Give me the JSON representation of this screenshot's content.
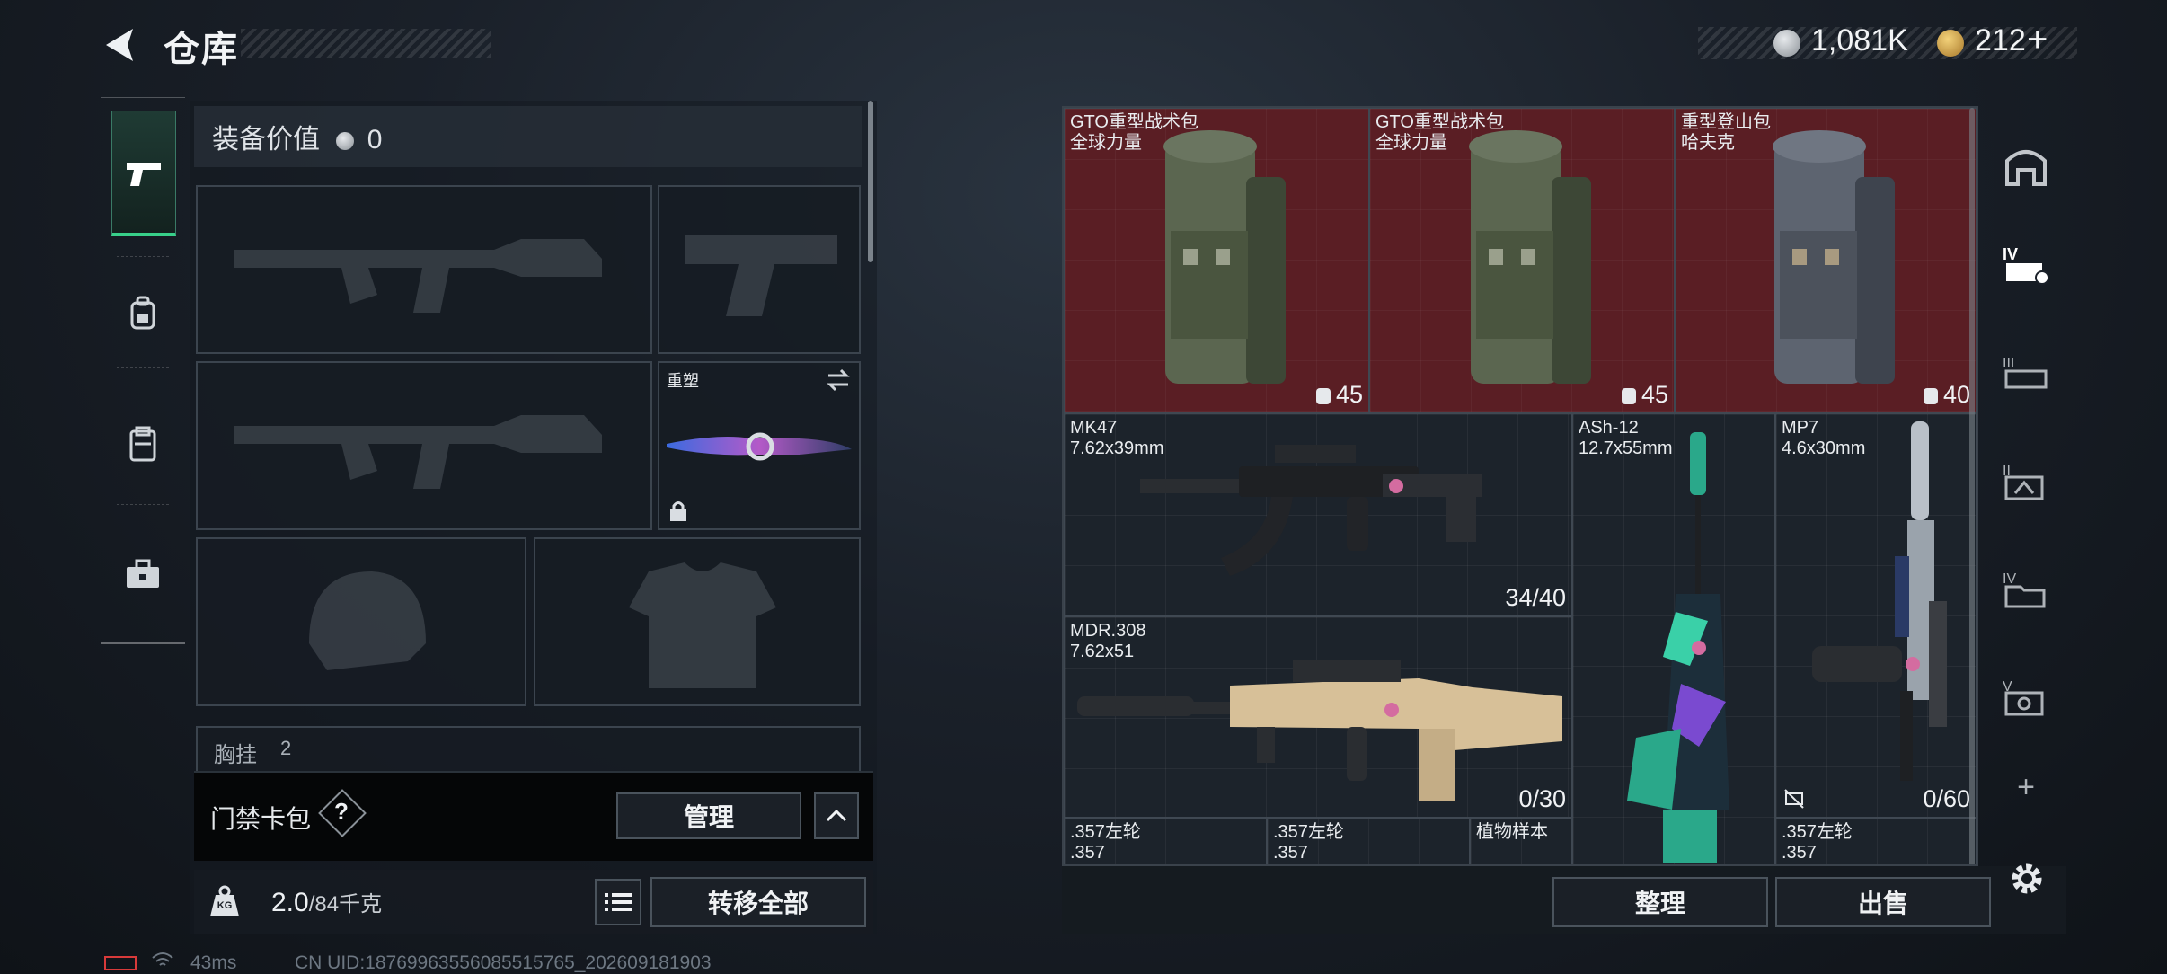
{
  "header": {
    "title": "仓库",
    "currency1_value": "1,081K",
    "currency2_value": "212",
    "add_symbol": "+"
  },
  "equipment": {
    "value_label": "装备价值",
    "value_amount": "0",
    "melee_label": "重塑",
    "chest_label": "胸挂",
    "chest_count": "2",
    "access_card_label": "门禁卡包",
    "help_symbol": "?",
    "manage_label": "管理",
    "weight_current": "2.0",
    "weight_max": "/84千克",
    "weight_icon_text": "KG",
    "transfer_all_label": "转移全部"
  },
  "stash": {
    "items": [
      {
        "name": "GTO重型战术包",
        "sub": "全球力量",
        "count": "45"
      },
      {
        "name": "GTO重型战术包",
        "sub": "全球力量",
        "count": "45"
      },
      {
        "name": "重型登山包",
        "sub": "哈夫克",
        "count": "40"
      },
      {
        "name": "MK47",
        "sub": "7.62x39mm",
        "count": "34/40"
      },
      {
        "name": "ASh-12",
        "sub": "12.7x55mm",
        "count": ""
      },
      {
        "name": "MP7",
        "sub": "4.6x30mm",
        "count": "0/60"
      },
      {
        "name": "MDR.308",
        "sub": "7.62x51",
        "count": "0/30"
      },
      {
        "name": ".357左轮",
        "sub": ".357",
        "count": ""
      },
      {
        "name": ".357左轮",
        "sub": ".357",
        "count": ""
      },
      {
        "name": "植物样本",
        "sub": "",
        "count": ""
      },
      {
        "name": ".357左轮",
        "sub": ".357",
        "count": ""
      }
    ],
    "sort_label": "整理",
    "sell_label": "出售"
  },
  "rail": {
    "add_symbol": "+"
  },
  "status": {
    "ping": "43ms",
    "uid": "CN UID:18769963556085515765_202609181903"
  },
  "colors": {
    "accent_green": "#38d08a",
    "red_cell": "#5a1e24",
    "battery_red": "#d83a3a"
  }
}
